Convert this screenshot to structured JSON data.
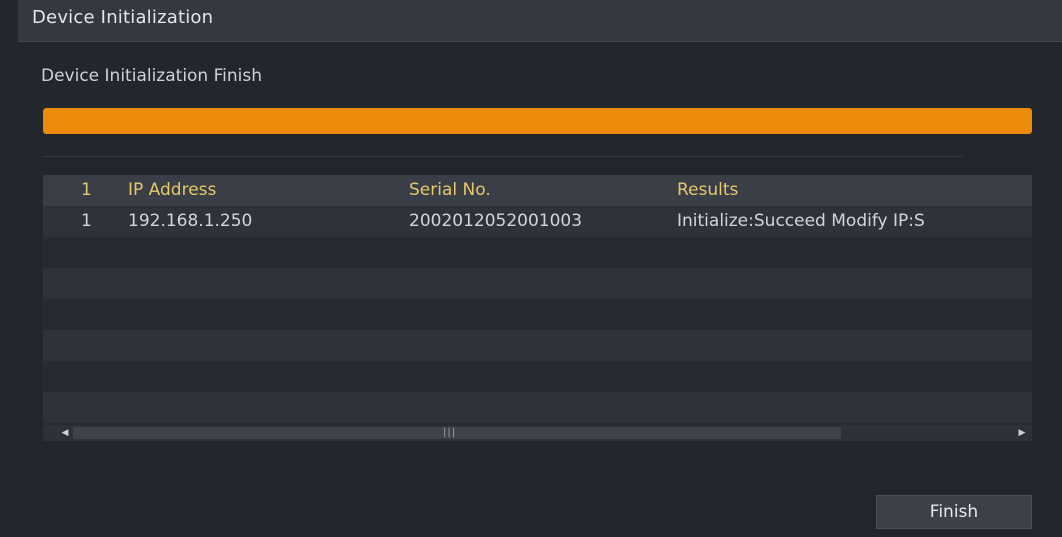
{
  "window": {
    "title": "Device Initialization"
  },
  "status": {
    "message": "Device Initialization Finish",
    "progress_percent": 100,
    "progress_color": "#ec8a0c"
  },
  "table": {
    "columns": [
      "1",
      "IP Address",
      "Serial No.",
      "Results"
    ],
    "rows": [
      [
        "1",
        "192.168.1.250",
        "2002012052001003",
        "Initialize:Succeed Modify IP:S"
      ]
    ],
    "header_text_color": "#e8c76a"
  },
  "scrollbar": {
    "left_icon": "scroll-left-arrow",
    "right_icon": "scroll-right-arrow",
    "grip": "|||"
  },
  "actions": {
    "finish_label": "Finish"
  }
}
